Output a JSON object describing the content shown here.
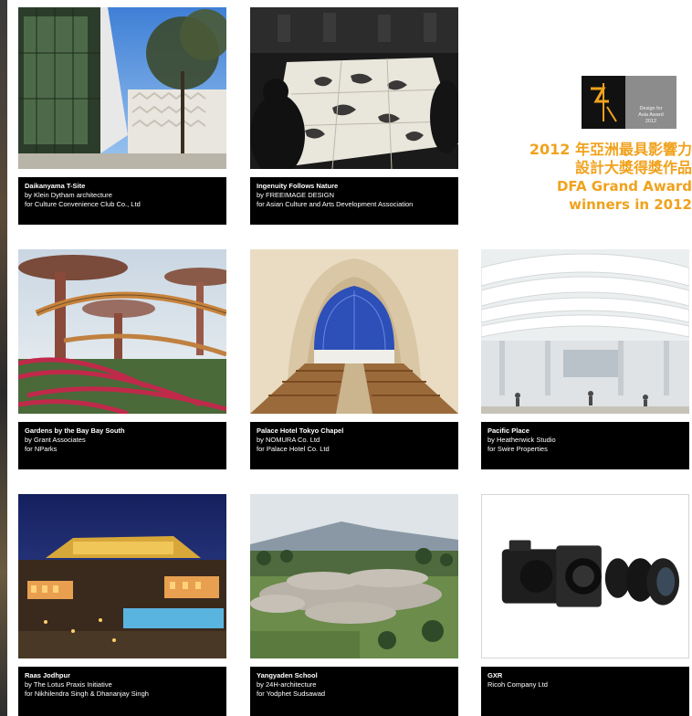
{
  "award": {
    "logo_caption": [
      "Design for",
      "Asia Award",
      "2012"
    ],
    "zh_line1": "2012 年亞洲最具影響力",
    "zh_line2": "設計大獎得獎作品",
    "en_line1": "DFA Grand Award",
    "en_line2": "winners in 2012"
  },
  "entries": [
    {
      "title": "Daikanyama T-Site",
      "line1": "by Klein Dytham architecture",
      "line2": "for Culture Convenience Club Co., Ltd",
      "image": "modern-building-photo"
    },
    {
      "title": "Ingenuity Follows Nature",
      "line1": "by FREEIMAGE DESIGN",
      "line2": "for Asian Culture and Arts Development Association",
      "image": "calligraphy-exhibition-photo"
    },
    {
      "title": "Gardens by the Bay Bay South",
      "line1": "by Grant Associates",
      "line2": "for NParks",
      "image": "supertree-garden-photo"
    },
    {
      "title": "Palace Hotel Tokyo Chapel",
      "line1": "by NOMURA Co. Ltd",
      "line2": "for Palace Hotel Co. Ltd",
      "image": "chapel-interior-photo"
    },
    {
      "title": "Pacific Place",
      "line1": "by Heatherwick Studio",
      "line2": "for Swire Properties",
      "image": "mall-interior-photo"
    },
    {
      "title": "Raas Jodhpur",
      "line1": "by The Lotus Praxis Initiative",
      "line2": "for Nikhilendra Singh & Dhananjay Singh",
      "image": "fort-hotel-night-photo"
    },
    {
      "title": "Yangyaden School",
      "line1": "by 24H-architecture",
      "line2": "for Yodphet Sudsawad",
      "image": "school-aerial-photo"
    },
    {
      "title": "GXR",
      "line1": "Ricoh Company Ltd",
      "line2": "",
      "image": "camera-product-photo"
    }
  ]
}
